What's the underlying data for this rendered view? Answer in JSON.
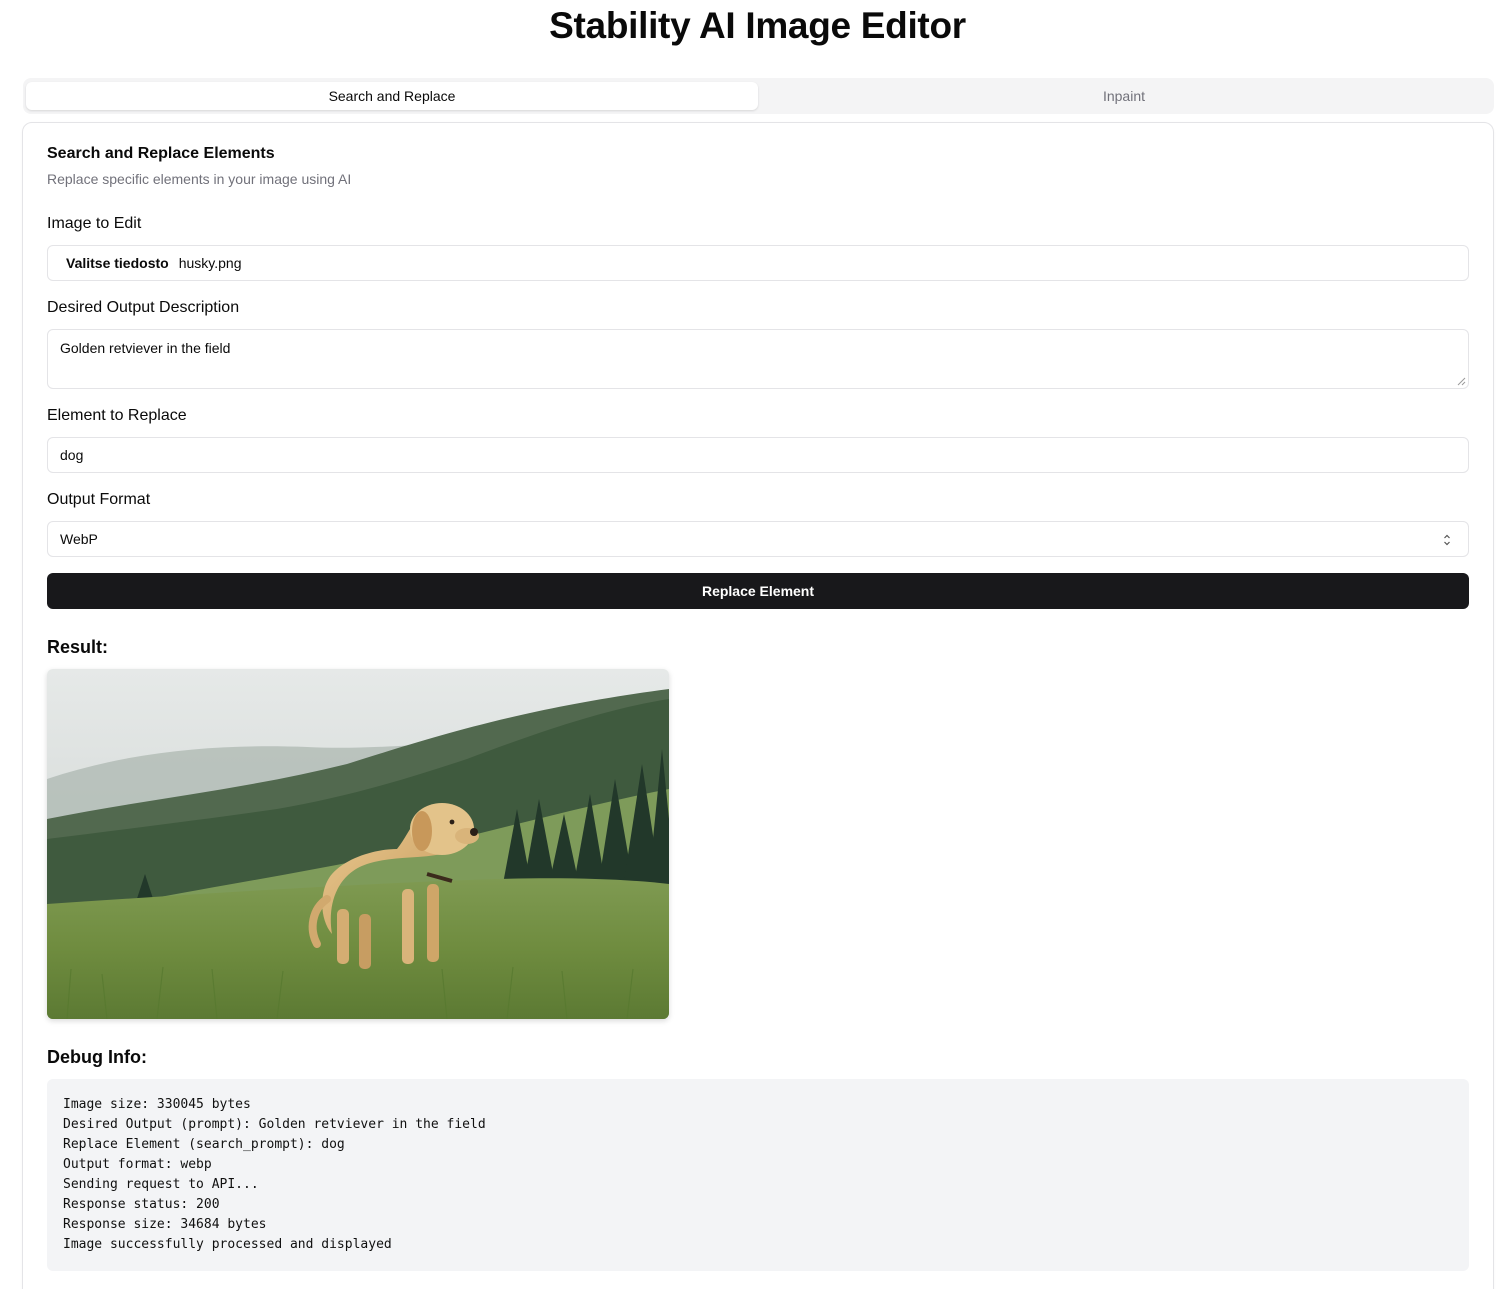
{
  "app": {
    "title": "Stability AI Image Editor"
  },
  "tabs": [
    {
      "label": "Search and Replace",
      "active": true
    },
    {
      "label": "Inpaint",
      "active": false
    }
  ],
  "card": {
    "title": "Search and Replace Elements",
    "description": "Replace specific elements in your image using AI"
  },
  "form": {
    "image": {
      "label": "Image to Edit",
      "button_label": "Valitse tiedosto",
      "file_name": "husky.png"
    },
    "description": {
      "label": "Desired Output Description",
      "value": "Golden retviever in the field"
    },
    "element": {
      "label": "Element to Replace",
      "value": "dog"
    },
    "format": {
      "label": "Output Format",
      "selected": "WebP"
    },
    "submit_label": "Replace Element"
  },
  "result": {
    "heading": "Result:",
    "image_alt": "Golden retriever standing in a grassy field with forested hills"
  },
  "debug": {
    "heading": "Debug Info:",
    "lines": [
      "Image size: 330045 bytes",
      "Desired Output (prompt): Golden retviever in the field",
      "Replace Element (search_prompt): dog",
      "Output format: webp",
      "Sending request to API...",
      "Response status: 200",
      "Response size: 34684 bytes",
      "Image successfully processed and displayed"
    ]
  }
}
